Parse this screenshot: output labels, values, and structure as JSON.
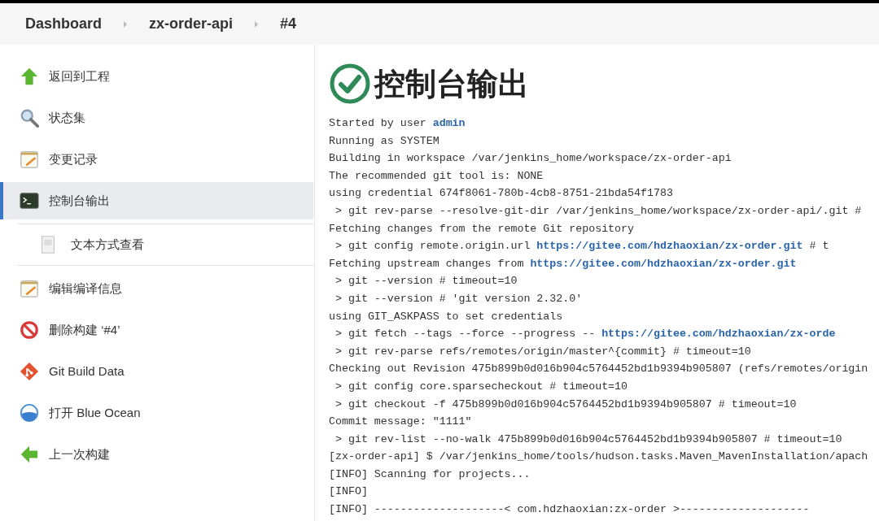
{
  "breadcrumbs": [
    {
      "label": "Dashboard"
    },
    {
      "label": "zx-order-api"
    },
    {
      "label": "#4"
    }
  ],
  "sidebar": {
    "items": [
      {
        "label": "返回到工程",
        "selected": false
      },
      {
        "label": "状态集",
        "selected": false
      },
      {
        "label": "变更记录",
        "selected": false
      },
      {
        "label": "控制台输出",
        "selected": true,
        "children": [
          {
            "label": "文本方式查看",
            "selected": false
          }
        ]
      },
      {
        "label": "编辑编译信息",
        "selected": false
      },
      {
        "label": "删除构建 ‘#4’",
        "selected": false
      },
      {
        "label": "Git Build Data",
        "selected": false
      },
      {
        "label": "打开 Blue Ocean",
        "selected": false
      },
      {
        "label": "上一次构建",
        "selected": false
      }
    ]
  },
  "console": {
    "title": "控制台输出",
    "lines": [
      [
        {
          "text": "Started by user "
        },
        {
          "text": "admin",
          "kind": "link"
        }
      ],
      [
        {
          "text": "Running as SYSTEM"
        }
      ],
      [
        {
          "text": "Building in workspace /var/jenkins_home/workspace/zx-order-api"
        }
      ],
      [
        {
          "text": "The recommended git tool is: NONE"
        }
      ],
      [
        {
          "text": "using credential 674f8061-780b-4cb8-8751-21bda54f1783"
        }
      ],
      [
        {
          "text": " > git rev-parse --resolve-git-dir /var/jenkins_home/workspace/zx-order-api/.git #"
        }
      ],
      [
        {
          "text": "Fetching changes from the remote Git repository"
        }
      ],
      [
        {
          "text": " > git config remote.origin.url "
        },
        {
          "text": "https://gitee.com/hdzhaoxian/zx-order.git",
          "kind": "link"
        },
        {
          "text": " # t"
        }
      ],
      [
        {
          "text": "Fetching upstream changes from "
        },
        {
          "text": "https://gitee.com/hdzhaoxian/zx-order.git",
          "kind": "link"
        }
      ],
      [
        {
          "text": " > git --version # timeout=10"
        }
      ],
      [
        {
          "text": " > git --version # 'git version 2.32.0'"
        }
      ],
      [
        {
          "text": "using GIT_ASKPASS to set credentials"
        }
      ],
      [
        {
          "text": " > git fetch --tags --force --progress -- "
        },
        {
          "text": "https://gitee.com/hdzhaoxian/zx-orde",
          "kind": "link"
        }
      ],
      [
        {
          "text": " > git rev-parse refs/remotes/origin/master^{commit} # timeout=10"
        }
      ],
      [
        {
          "text": "Checking out Revision 475b899b0d016b904c5764452bd1b9394b905807 (refs/remotes/origin"
        }
      ],
      [
        {
          "text": " > git config core.sparsecheckout # timeout=10"
        }
      ],
      [
        {
          "text": " > git checkout -f 475b899b0d016b904c5764452bd1b9394b905807 # timeout=10"
        }
      ],
      [
        {
          "text": "Commit message: \"1111\""
        }
      ],
      [
        {
          "text": " > git rev-list --no-walk 475b899b0d016b904c5764452bd1b9394b905807 # timeout=10"
        }
      ],
      [
        {
          "text": "[zx-order-api] $ /var/jenkins_home/tools/hudson.tasks.Maven_MavenInstallation/apach"
        }
      ],
      [
        {
          "text": "[INFO] Scanning for projects..."
        }
      ],
      [
        {
          "text": "[INFO]"
        }
      ],
      [
        {
          "text": "[INFO] --------------------< com.hdzhaoxian:zx-order >--------------------"
        }
      ]
    ]
  }
}
